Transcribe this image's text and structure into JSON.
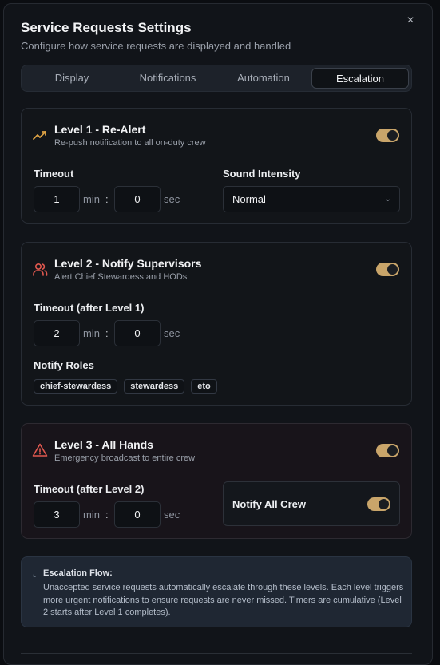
{
  "modal": {
    "title": "Service Requests Settings",
    "subtitle": "Configure how service requests are displayed and handled",
    "close_icon": "×"
  },
  "tabs": [
    {
      "label": "Display",
      "active": false
    },
    {
      "label": "Notifications",
      "active": false
    },
    {
      "label": "Automation",
      "active": false
    },
    {
      "label": "Escalation",
      "active": true
    }
  ],
  "levels": [
    {
      "title": "Level 1 - Re-Alert",
      "description": "Re-push notification to all on-duty crew",
      "icon": "trending-up-icon",
      "enabled": true,
      "timeout_label": "Timeout",
      "minutes": "1",
      "seconds": "0",
      "min_unit": "min",
      "sec_unit": "sec",
      "colon": ":",
      "sound_label": "Sound Intensity",
      "sound_value": "Normal"
    },
    {
      "title": "Level 2 - Notify Supervisors",
      "description": "Alert Chief Stewardess and HODs",
      "icon": "users-icon",
      "enabled": true,
      "timeout_label": "Timeout (after Level 1)",
      "minutes": "2",
      "seconds": "0",
      "min_unit": "min",
      "sec_unit": "sec",
      "colon": ":",
      "roles_label": "Notify Roles",
      "roles": [
        "chief-stewardess",
        "stewardess",
        "eto"
      ]
    },
    {
      "title": "Level 3 - All Hands",
      "description": "Emergency broadcast to entire crew",
      "icon": "alert-triangle-icon",
      "enabled": true,
      "timeout_label": "Timeout (after Level 2)",
      "minutes": "3",
      "seconds": "0",
      "min_unit": "min",
      "sec_unit": "sec",
      "colon": ":",
      "notify_all_label": "Notify All Crew",
      "notify_all_enabled": true
    }
  ],
  "info": {
    "title": "Escalation Flow:",
    "body": "Unaccepted service requests automatically escalate through these levels. Each level triggers more urgent notifications to ensure requests are never missed. Timers are cumulative (Level 2 starts after Level 1 completes)."
  },
  "colors": {
    "accent": "#c9a56a",
    "level1_icon": "#e0a445",
    "level2_icon": "#e0584f",
    "level3_icon": "#e0584f"
  }
}
